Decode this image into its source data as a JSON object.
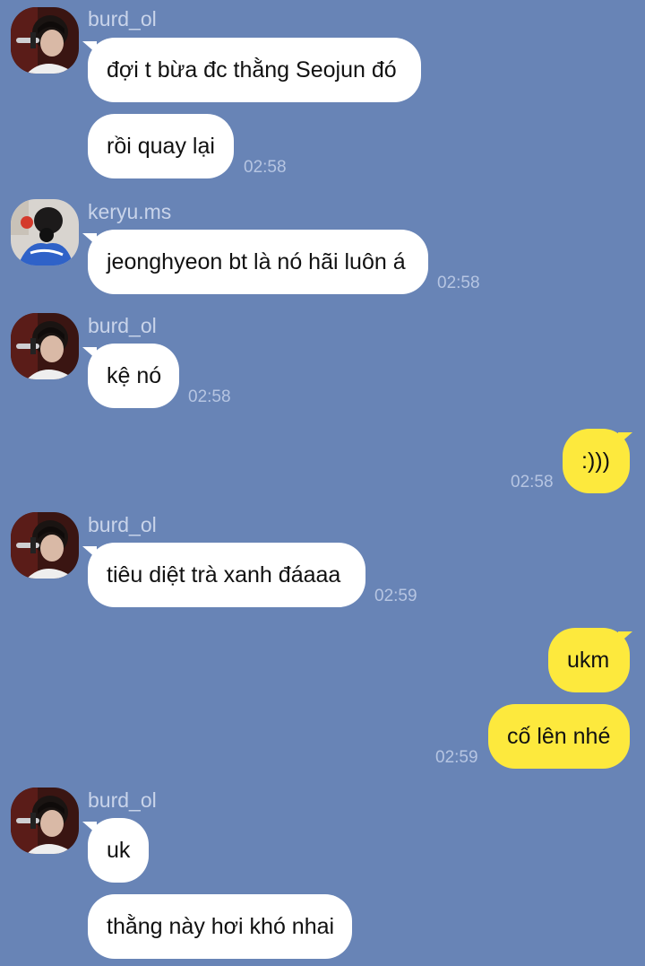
{
  "colors": {
    "background": "#6884b6",
    "incoming_bubble": "#ffffff",
    "outgoing_bubble": "#fde93d",
    "timestamp": "#b6c5e2",
    "sender_name": "#c9d4ea"
  },
  "messages": [
    {
      "sender": "burd_ol",
      "avatar": "avatar-burd-ol-icon",
      "lines": [
        "đợi t bừa đc thằng Seojun đó",
        "rồi quay lại"
      ],
      "time": "02:58"
    },
    {
      "sender": "keryu.ms",
      "avatar": "avatar-keryu-ms-icon",
      "lines": [
        "jeonghyeon bt là nó hãi luôn á"
      ],
      "time": "02:58"
    },
    {
      "sender": "burd_ol",
      "avatar": "avatar-burd-ol-icon",
      "lines": [
        "kệ nó"
      ],
      "time": "02:58"
    },
    {
      "sender": "me",
      "lines": [
        ":)))"
      ],
      "time": "02:58"
    },
    {
      "sender": "burd_ol",
      "avatar": "avatar-burd-ol-icon",
      "lines": [
        "tiêu diệt trà xanh đáaaa"
      ],
      "time": "02:59"
    },
    {
      "sender": "me",
      "lines": [
        "ukm",
        "cố lên nhé"
      ],
      "time": "02:59"
    },
    {
      "sender": "burd_ol",
      "avatar": "avatar-burd-ol-icon",
      "lines": [
        "uk",
        "thằng này hơi khó nhai"
      ],
      "time": ""
    }
  ]
}
